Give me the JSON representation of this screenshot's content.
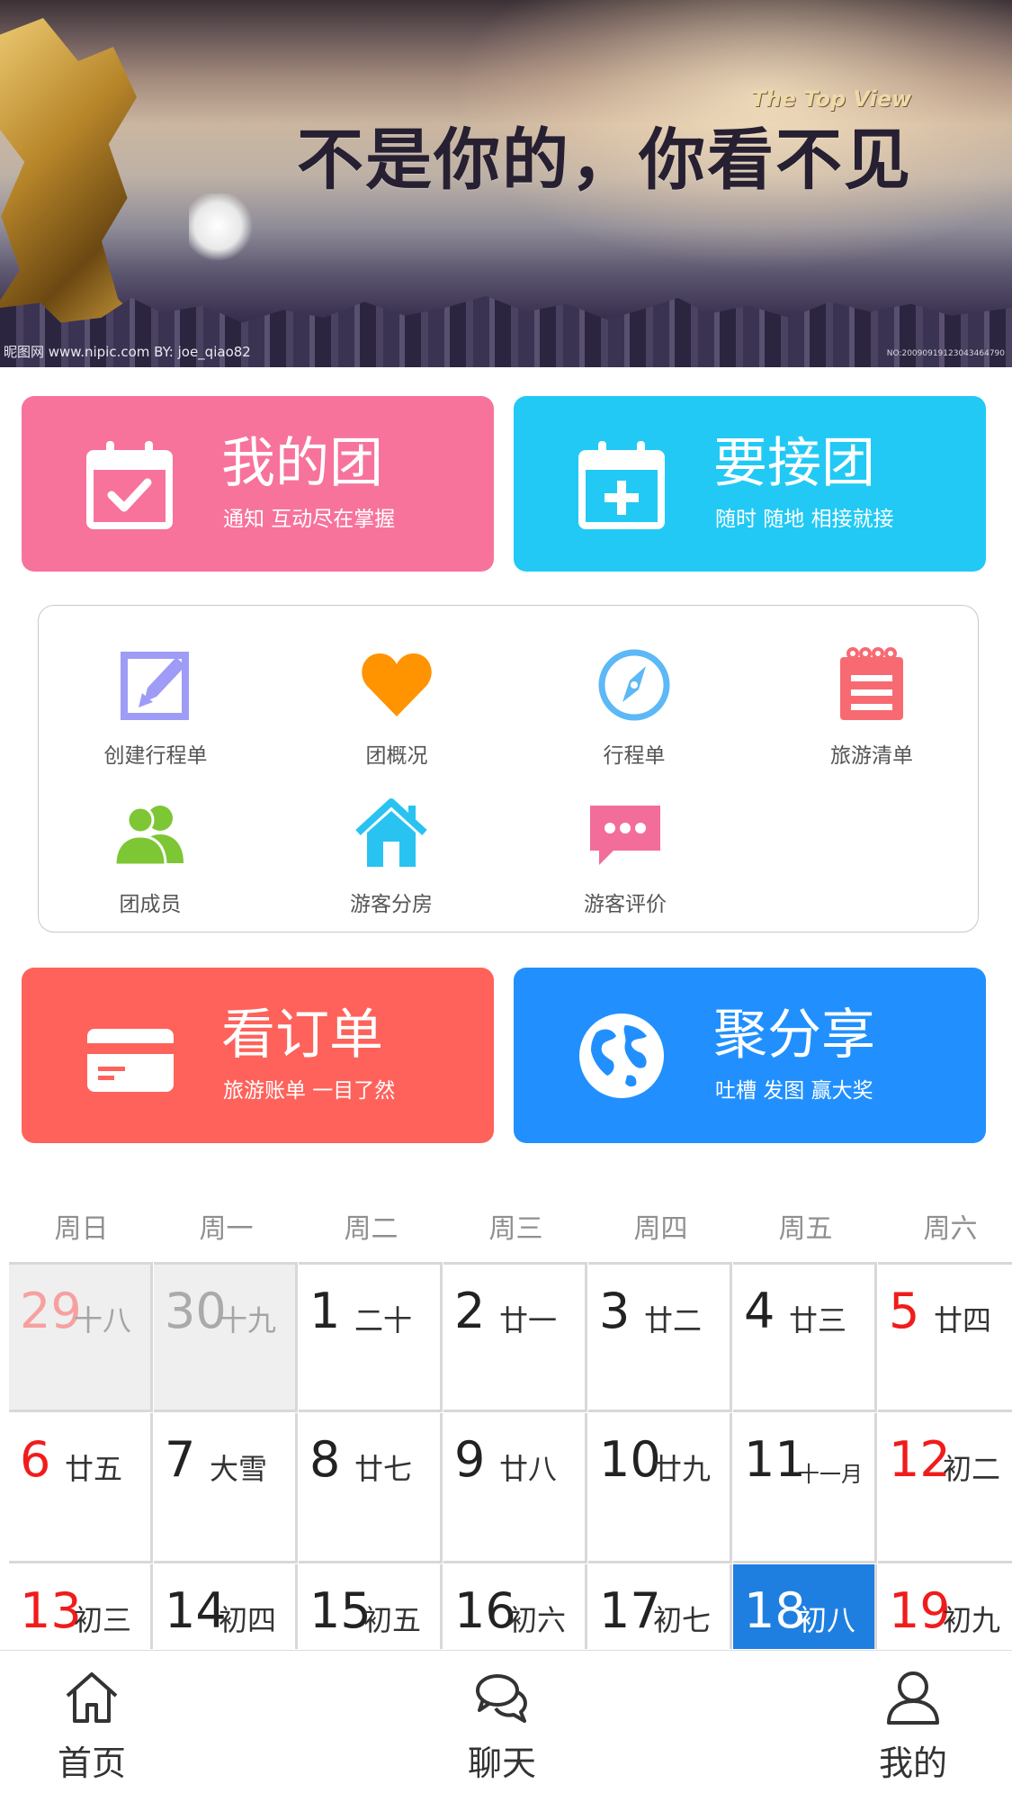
{
  "banner": {
    "slogan": "不是你的，你看不见",
    "tagline": "The Top View",
    "credit": "昵图网 www.nipic.com   BY: joe_qiao82",
    "serial": "NO:20090919123043464790"
  },
  "cards": {
    "my_group": {
      "title": "我的团",
      "subtitle": "通知 互动尽在掌握",
      "icon": "calendar-check-icon",
      "color": "#f7739c"
    },
    "join_group": {
      "title": "要接团",
      "subtitle": "随时 随地 相接就接",
      "icon": "calendar-plus-icon",
      "color": "#22c9f4"
    },
    "orders": {
      "title": "看订单",
      "subtitle": "旅游账单 一目了然",
      "icon": "credit-card-icon",
      "color": "#fe625b"
    },
    "share": {
      "title": "聚分享",
      "subtitle": "吐槽 发图 赢大奖",
      "icon": "globe-icon",
      "color": "#2190fe"
    }
  },
  "features": [
    {
      "label": "创建行程单",
      "icon": "edit-icon",
      "color": "#9e9cf6"
    },
    {
      "label": "团概况",
      "icon": "heart-icon",
      "color": "#ff9300"
    },
    {
      "label": "行程单",
      "icon": "compass-icon",
      "color": "#5cb8f6"
    },
    {
      "label": "旅游清单",
      "icon": "notepad-icon",
      "color": "#f86a72"
    },
    {
      "label": "团成员",
      "icon": "users-icon",
      "color": "#7dc634"
    },
    {
      "label": "游客分房",
      "icon": "house-icon",
      "color": "#29c3f1"
    },
    {
      "label": "游客评价",
      "icon": "chat-bubble-icon",
      "color": "#f26d9a"
    }
  ],
  "calendar": {
    "weekdays": [
      "周日",
      "周一",
      "周二",
      "周三",
      "周四",
      "周五",
      "周六"
    ],
    "weeks": [
      [
        {
          "day": "29",
          "lunar": "十八",
          "state": "prev"
        },
        {
          "day": "30",
          "lunar": "十九",
          "state": "prev"
        },
        {
          "day": "1",
          "lunar": "二十",
          "state": ""
        },
        {
          "day": "2",
          "lunar": "廿一",
          "state": ""
        },
        {
          "day": "3",
          "lunar": "廿二",
          "state": ""
        },
        {
          "day": "4",
          "lunar": "廿三",
          "state": ""
        },
        {
          "day": "5",
          "lunar": "廿四",
          "state": "weekend"
        }
      ],
      [
        {
          "day": "6",
          "lunar": "廿五",
          "state": "weekend"
        },
        {
          "day": "7",
          "lunar": "大雪",
          "state": ""
        },
        {
          "day": "8",
          "lunar": "廿七",
          "state": ""
        },
        {
          "day": "9",
          "lunar": "廿八",
          "state": ""
        },
        {
          "day": "10",
          "lunar": "廿九",
          "state": ""
        },
        {
          "day": "11",
          "lunar": "十一月",
          "state": ""
        },
        {
          "day": "12",
          "lunar": "初二",
          "state": "weekend"
        }
      ],
      [
        {
          "day": "13",
          "lunar": "初三",
          "state": "weekend"
        },
        {
          "day": "14",
          "lunar": "初四",
          "state": ""
        },
        {
          "day": "15",
          "lunar": "初五",
          "state": ""
        },
        {
          "day": "16",
          "lunar": "初六",
          "state": ""
        },
        {
          "day": "17",
          "lunar": "初七",
          "state": ""
        },
        {
          "day": "18",
          "lunar": "初八",
          "state": "today"
        },
        {
          "day": "19",
          "lunar": "初九",
          "state": "weekend"
        }
      ]
    ],
    "colors": {
      "weekend": "#f01c1c",
      "today": "#1f7fe0",
      "prev_bg": "#efefef"
    }
  },
  "tabbar": [
    {
      "label": "首页",
      "icon": "home-icon"
    },
    {
      "label": "聊天",
      "icon": "chat-icon"
    },
    {
      "label": "我的",
      "icon": "user-icon"
    }
  ]
}
